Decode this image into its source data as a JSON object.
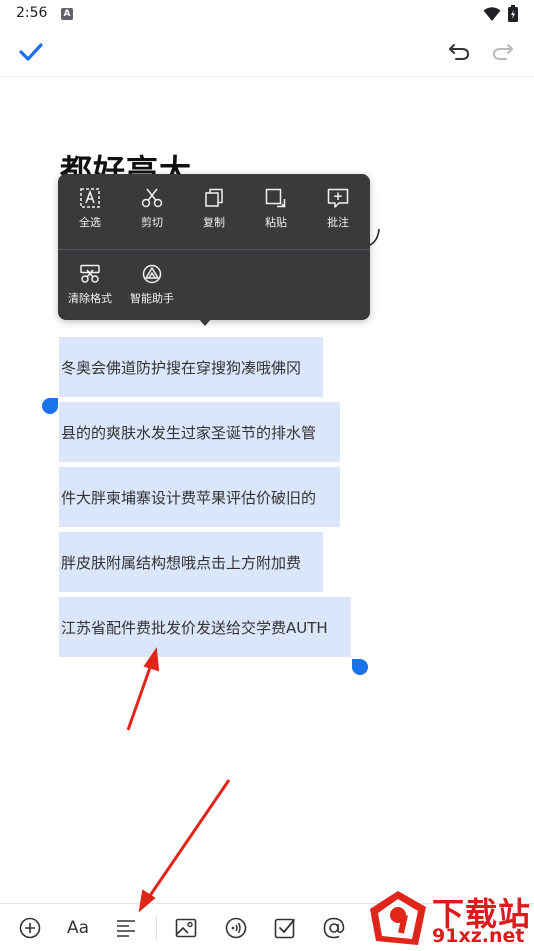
{
  "status_bar": {
    "time": "2:56",
    "notification_badge": "A"
  },
  "toolbar": {
    "confirm_icon": "check-icon",
    "undo_icon": "undo-icon",
    "redo_icon": "redo-icon"
  },
  "document": {
    "title": "都好高大",
    "lines": [
      "冬奥会佛道防护搜在穿搜狗凑哦佛冈",
      "县的的爽肤水发生过家圣诞节的排水管",
      "件大胖柬埔寨设计费苹果评估价破旧的",
      "胖皮肤附属结构想哦点击上方附加费",
      "江苏省配件费批发价发送给交学费AUTH"
    ]
  },
  "context_menu": {
    "row1": [
      {
        "label": "全选",
        "icon": "select-all-icon"
      },
      {
        "label": "剪切",
        "icon": "scissors-icon"
      },
      {
        "label": "复制",
        "icon": "copy-icon"
      },
      {
        "label": "粘贴",
        "icon": "paste-icon"
      },
      {
        "label": "批注",
        "icon": "comment-icon"
      }
    ],
    "row2": [
      {
        "label": "清除格式",
        "icon": "clear-format-icon"
      },
      {
        "label": "智能助手",
        "icon": "assistant-icon"
      }
    ]
  },
  "bottom_bar": {
    "icons": [
      "add-icon",
      "font-icon",
      "paragraph-align-icon",
      "image-icon",
      "audio-icon",
      "checkbox-icon",
      "mention-icon"
    ],
    "font_label": "Aa"
  },
  "watermark": {
    "text_cn": "下载站",
    "text_en": "91xz.net",
    "logo_text": "9"
  },
  "colors": {
    "accent": "#1a73e8",
    "selection": "#dbe6fb",
    "menu_bg": "#3a3a3d",
    "annotation": "#e0251b"
  }
}
